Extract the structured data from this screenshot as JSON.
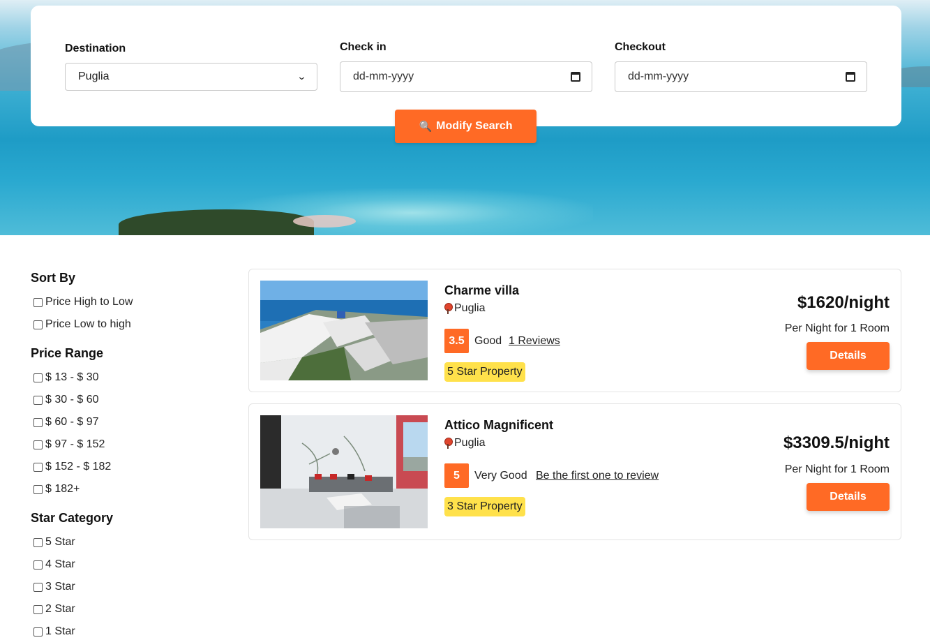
{
  "search": {
    "destination_label": "Destination",
    "destination_value": "Puglia",
    "checkin_label": "Check in",
    "checkin_placeholder": "dd-mm-yyyy",
    "checkout_label": "Checkout",
    "checkout_placeholder": "dd-mm-yyyy",
    "modify_button": "Modify Search"
  },
  "sidebar": {
    "sort_title": "Sort By",
    "sort_options": [
      "Price High to Low",
      "Price Low to high"
    ],
    "price_title": "Price Range",
    "price_options": [
      "$ 13 - $ 30",
      "$ 30 - $ 60",
      "$ 60 - $ 97",
      "$ 97 - $ 152",
      "$ 152 - $ 182",
      "$ 182+"
    ],
    "star_title": "Star Category",
    "star_options": [
      "5 Star",
      "4 Star",
      "3 Star",
      "2 Star",
      "1 Star"
    ]
  },
  "hotels": [
    {
      "name": "Charme villa",
      "location": "Puglia",
      "score": "3.5",
      "rating_word": "Good",
      "review_text": "1 Reviews",
      "star_tag": "5 Star Property",
      "price": "$1620/night",
      "per_night": "Per Night for 1 Room",
      "details": "Details"
    },
    {
      "name": "Attico Magnificent",
      "location": "Puglia",
      "score": "5",
      "rating_word": "Very Good",
      "review_text": "Be the first one to review",
      "star_tag": "3 Star Property",
      "price": "$3309.5/night",
      "per_night": "Per Night for 1 Room",
      "details": "Details"
    }
  ],
  "colors": {
    "accent": "#ff6a25",
    "star_tag": "#ffe14b"
  },
  "icons": {
    "search": "magnifier-icon",
    "location": "map-pin-icon",
    "calendar": "calendar-icon",
    "dropdown": "chevron-down-icon"
  }
}
